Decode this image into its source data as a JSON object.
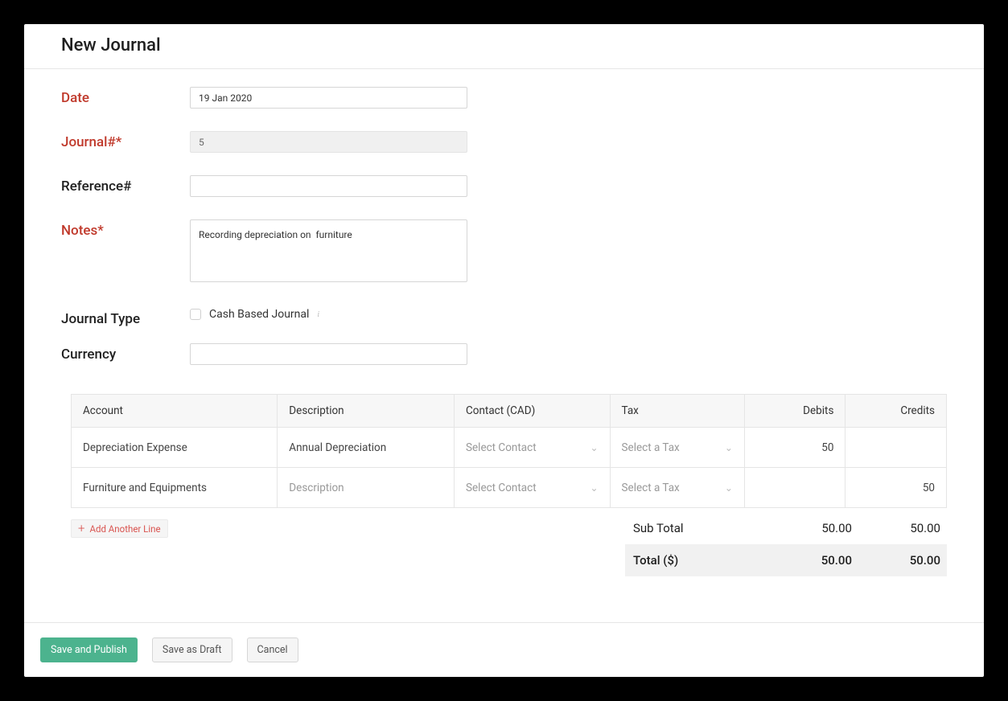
{
  "header": {
    "title": "New Journal"
  },
  "fields": {
    "date": {
      "label": "Date",
      "value": "19 Jan 2020"
    },
    "journal_no": {
      "label": "Journal#*",
      "value": "5"
    },
    "reference": {
      "label": "Reference#",
      "value": ""
    },
    "notes": {
      "label": "Notes*",
      "value": "Recording depreciation on  furniture"
    },
    "journal_type": {
      "label": "Journal Type",
      "checkbox_label": "Cash Based Journal"
    },
    "currency": {
      "label": "Currency",
      "value": ""
    }
  },
  "table": {
    "headers": {
      "account": "Account",
      "description": "Description",
      "contact": "Contact (CAD)",
      "tax": "Tax",
      "debits": "Debits",
      "credits": "Credits"
    },
    "placeholders": {
      "contact": "Select Contact",
      "tax": "Select a Tax",
      "description": "Description"
    },
    "rows": [
      {
        "account": "Depreciation Expense",
        "description": "Annual Depreciation",
        "debit": "50",
        "credit": ""
      },
      {
        "account": "Furniture and Equipments",
        "description": "",
        "debit": "",
        "credit": "50"
      }
    ],
    "add_line_label": "Add Another Line"
  },
  "totals": {
    "subtotal_label": "Sub Total",
    "subtotal_debit": "50.00",
    "subtotal_credit": "50.00",
    "total_label": "Total ($)",
    "total_debit": "50.00",
    "total_credit": "50.00"
  },
  "footer": {
    "save_publish": "Save and Publish",
    "save_draft": "Save as Draft",
    "cancel": "Cancel"
  }
}
